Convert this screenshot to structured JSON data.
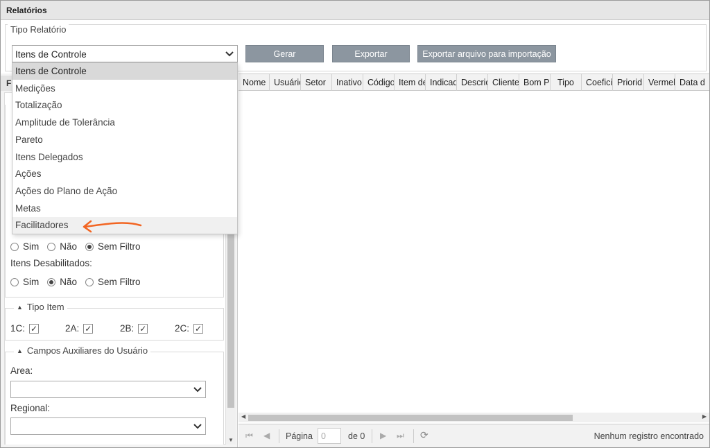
{
  "window": {
    "title": "Relatórios"
  },
  "tipo_relatorio": {
    "legend": "Tipo Relatório",
    "selected": "Itens de Controle",
    "options": [
      "Itens de Controle",
      "Medições",
      "Totalização",
      "Amplitude de Tolerância",
      "Pareto",
      "Itens Delegados",
      "Ações",
      "Ações do Plano de Ação",
      "Metas",
      "Facilitadores"
    ],
    "hovered": "Facilitadores"
  },
  "toolbar": {
    "gerar": "Gerar",
    "exportar": "Exportar",
    "exportar_arquivo": "Exportar arquivo para importação"
  },
  "filters": {
    "panel_tab": "F",
    "radio_group_1": {
      "options": [
        "Sim",
        "Não",
        "Sem Filtro"
      ],
      "selected": "Sem Filtro"
    },
    "itens_desabilitados": {
      "label": "Itens Desabilitados:",
      "options": [
        "Sim",
        "Não",
        "Sem Filtro"
      ],
      "selected": "Não"
    },
    "tipo_item": {
      "title": "Tipo Item",
      "items": [
        {
          "label": "1C:",
          "checked": true
        },
        {
          "label": "2A:",
          "checked": true
        },
        {
          "label": "2B:",
          "checked": true
        },
        {
          "label": "2C:",
          "checked": true
        }
      ]
    },
    "campos_auxiliares": {
      "title": "Campos Auxiliares do Usuário",
      "area_label": "Area:",
      "regional_label": "Regional:"
    }
  },
  "grid": {
    "columns": [
      "Nome",
      "Usuário",
      "Setor",
      "Inativo",
      "Código",
      "Item de",
      "Indicad",
      "Descriç",
      "Cliente",
      "Bom Pa",
      "Tipo",
      "Coefici",
      "Priorid",
      "Vermel",
      "Data d"
    ],
    "pager": {
      "page_label": "Página",
      "page_value": "0",
      "of_label": "de 0",
      "status": "Nenhum registro encontrado"
    }
  },
  "annotation": {
    "arrow_color": "#f26522"
  }
}
